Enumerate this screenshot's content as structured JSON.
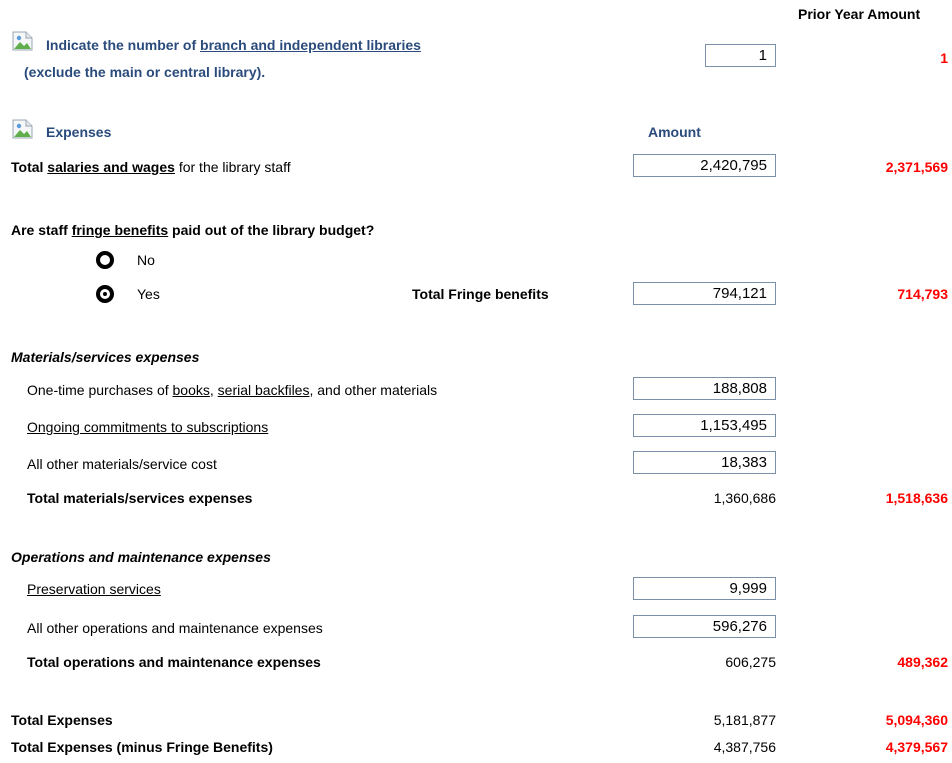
{
  "header": {
    "prior_year_label": "Prior Year Amount"
  },
  "branches": {
    "question_prefix": "Indicate the number of ",
    "question_link": "branch and independent libraries",
    "question_line2": "(exclude the main or central library).",
    "value": "1",
    "prior": "1"
  },
  "expenses": {
    "heading": "Expenses",
    "amount_label": "Amount",
    "salaries": {
      "prefix": "Total ",
      "link": "salaries and wages",
      "suffix": " for the library staff",
      "value": "2,420,795",
      "prior": "2,371,569"
    },
    "fringe": {
      "question_prefix": "Are staff ",
      "question_link": "fringe benefits",
      "question_suffix": " paid out of the library budget?",
      "option_no": "No",
      "option_yes": "Yes",
      "selected": "Yes",
      "total_label": "Total Fringe benefits",
      "value": "794,121",
      "prior": "714,793"
    }
  },
  "materials": {
    "heading": "Materials/services expenses",
    "onetime": {
      "prefix": "One-time purchases of ",
      "link1": "books",
      "sep1": ", ",
      "link2": "serial backfiles",
      "suffix": ", and other materials",
      "value": "188,808"
    },
    "ongoing": {
      "link": "Ongoing commitments to subscriptions",
      "value": "1,153,495"
    },
    "other": {
      "label": "All other materials/service cost",
      "value": "18,383"
    },
    "total": {
      "label": "Total materials/services expenses",
      "value": "1,360,686",
      "prior": "1,518,636"
    }
  },
  "operations": {
    "heading": "Operations and maintenance expenses",
    "preservation": {
      "link": "Preservation services",
      "value": "9,999"
    },
    "other": {
      "label": "All other operations and maintenance expenses",
      "value": "596,276"
    },
    "total": {
      "label": "Total operations and maintenance expenses",
      "value": "606,275",
      "prior": "489,362"
    }
  },
  "totals": {
    "total_expenses_label": "Total Expenses",
    "total_expenses_value": "5,181,877",
    "total_expenses_prior": "5,094,360",
    "minus_fringe_label": "Total Expenses (minus Fringe Benefits)",
    "minus_fringe_value": "4,387,756",
    "minus_fringe_prior": "4,379,567"
  },
  "colors": {
    "heading_navy": "#2a4b7c",
    "prior_red": "#ff0000",
    "input_border": "#7a90a8"
  },
  "icons": {
    "section_icon": "broken-image-icon",
    "radio_icon": "radio-button"
  }
}
